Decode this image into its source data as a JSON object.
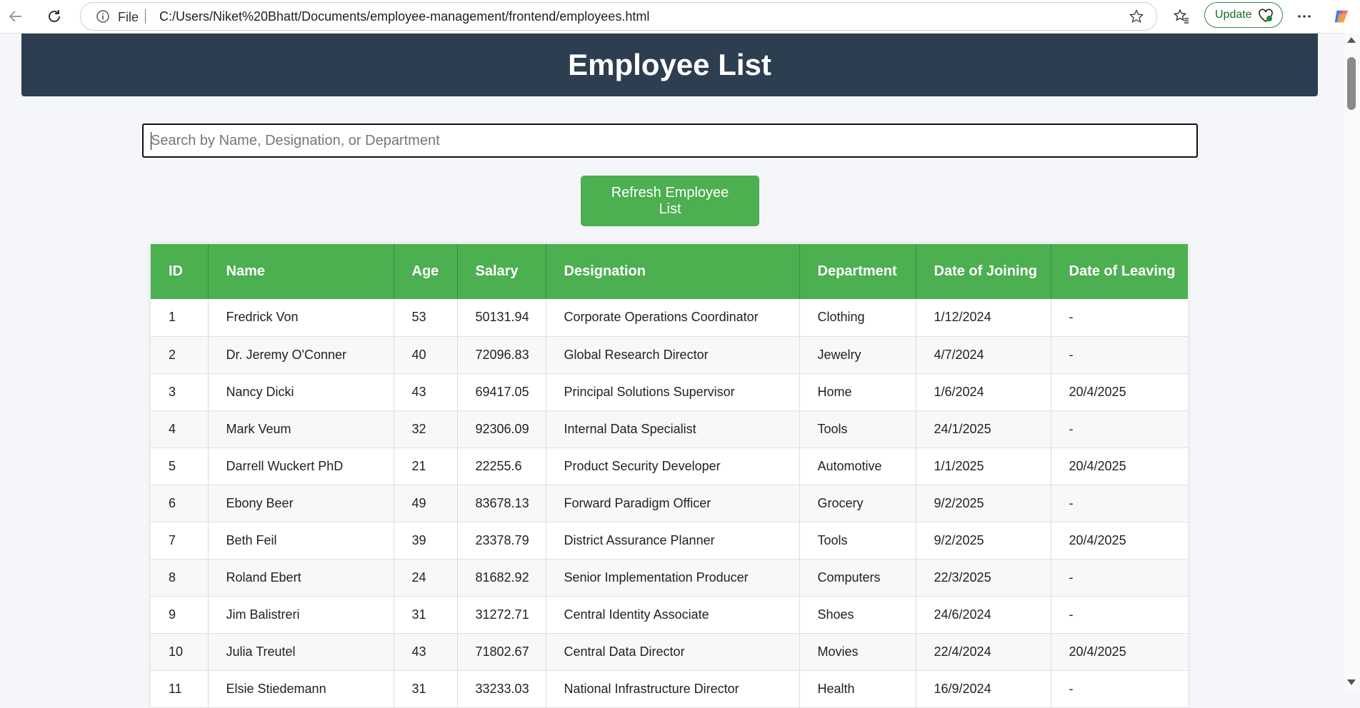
{
  "browser": {
    "file_label": "File",
    "url": "C:/Users/Niket%20Bhatt/Documents/employee-management/frontend/employees.html",
    "update_label": "Update"
  },
  "page": {
    "title": "Employee List",
    "search_placeholder": "Search by Name, Designation, or Department",
    "refresh_label": "Refresh Employee List"
  },
  "table": {
    "headers": [
      "ID",
      "Name",
      "Age",
      "Salary",
      "Designation",
      "Department",
      "Date of Joining",
      "Date of Leaving"
    ],
    "rows": [
      [
        "1",
        "Fredrick Von",
        "53",
        "50131.94",
        "Corporate Operations Coordinator",
        "Clothing",
        "1/12/2024",
        "-"
      ],
      [
        "2",
        "Dr. Jeremy O'Conner",
        "40",
        "72096.83",
        "Global Research Director",
        "Jewelry",
        "4/7/2024",
        "-"
      ],
      [
        "3",
        "Nancy Dicki",
        "43",
        "69417.05",
        "Principal Solutions Supervisor",
        "Home",
        "1/6/2024",
        "20/4/2025"
      ],
      [
        "4",
        "Mark Veum",
        "32",
        "92306.09",
        "Internal Data Specialist",
        "Tools",
        "24/1/2025",
        "-"
      ],
      [
        "5",
        "Darrell Wuckert PhD",
        "21",
        "22255.6",
        "Product Security Developer",
        "Automotive",
        "1/1/2025",
        "20/4/2025"
      ],
      [
        "6",
        "Ebony Beer",
        "49",
        "83678.13",
        "Forward Paradigm Officer",
        "Grocery",
        "9/2/2025",
        "-"
      ],
      [
        "7",
        "Beth Feil",
        "39",
        "23378.79",
        "District Assurance Planner",
        "Tools",
        "9/2/2025",
        "20/4/2025"
      ],
      [
        "8",
        "Roland Ebert",
        "24",
        "81682.92",
        "Senior Implementation Producer",
        "Computers",
        "22/3/2025",
        "-"
      ],
      [
        "9",
        "Jim Balistreri",
        "31",
        "31272.71",
        "Central Identity Associate",
        "Shoes",
        "24/6/2024",
        "-"
      ],
      [
        "10",
        "Julia Treutel",
        "43",
        "71802.67",
        "Central Data Director",
        "Movies",
        "22/4/2024",
        "20/4/2025"
      ],
      [
        "11",
        "Elsie Stiedemann",
        "31",
        "33233.03",
        "National Infrastructure Director",
        "Health",
        "16/9/2024",
        "-"
      ]
    ]
  },
  "colors": {
    "header_bg": "#2c3e50",
    "accent_green": "#4caf50"
  }
}
